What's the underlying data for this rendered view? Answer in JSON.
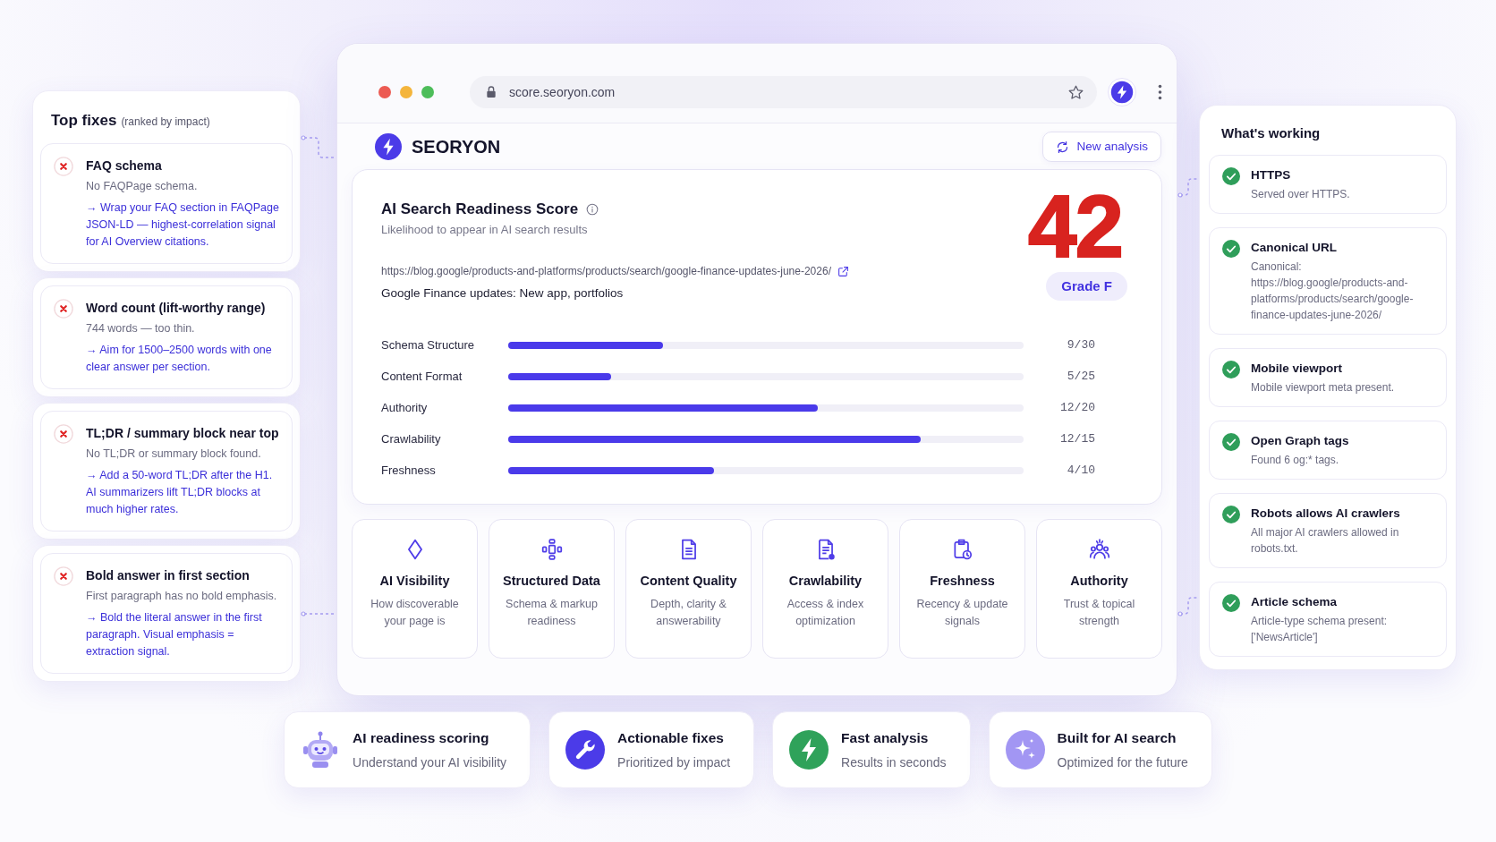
{
  "top_fixes": {
    "title": "Top fixes",
    "subtitle": "(ranked by impact)",
    "items": [
      {
        "title": "FAQ schema",
        "detail": "No FAQPage schema.",
        "fix": "→ Wrap your FAQ section in FAQPage JSON-LD — highest-correlation signal for AI Overview citations."
      },
      {
        "title": "Word count (lift-worthy range)",
        "detail": "744 words — too thin.",
        "fix": "→ Aim for 1500–2500 words with one clear answer per section."
      },
      {
        "title": "TL;DR / summary block near top",
        "detail": "No TL;DR or summary block found.",
        "fix": "→ Add a 50-word TL;DR after the H1. AI summarizers lift TL;DR blocks at much higher rates."
      },
      {
        "title": "Bold answer in first section",
        "detail": "First paragraph has no bold emphasis.",
        "fix": "→ Bold the literal answer in the first paragraph. Visual emphasis = extraction signal."
      }
    ]
  },
  "browser": {
    "url": "score.seoryon.com"
  },
  "header": {
    "brand": "SEORYON",
    "button": "New analysis"
  },
  "score_card": {
    "title": "AI Search Readiness Score",
    "subtitle": "Likelihood to appear in AI search results",
    "url": "https://blog.google/products-and-platforms/products/search/google-finance-updates-june-2026/",
    "page_title": "Google Finance updates: New app, portfolios",
    "score": "42",
    "grade": "Grade F",
    "metrics": [
      {
        "name": "Schema Structure",
        "level": 0.3,
        "reading": "9/30"
      },
      {
        "name": "Content Format",
        "level": 0.2,
        "reading": "5/25"
      },
      {
        "name": "Authority",
        "level": 0.6,
        "reading": "12/20"
      },
      {
        "name": "Crawlability",
        "level": 0.8,
        "reading": "12/15"
      },
      {
        "name": "Freshness",
        "level": 0.4,
        "reading": "4/10"
      }
    ]
  },
  "categories": [
    {
      "title": "AI Visibility",
      "description": "How discoverable your page is"
    },
    {
      "title": "Structured Data",
      "description": "Schema & markup readiness"
    },
    {
      "title": "Content Quality",
      "description": "Depth, clarity & answerability"
    },
    {
      "title": "Crawlability",
      "description": "Access & index optimization"
    },
    {
      "title": "Freshness",
      "description": "Recency & update signals"
    },
    {
      "title": "Authority",
      "description": "Trust & topical strength"
    }
  ],
  "whats_working": {
    "title": "What's working",
    "items": [
      {
        "title": "HTTPS",
        "detail": "Served over HTTPS."
      },
      {
        "title": "Canonical URL",
        "detail": "Canonical: https://blog.google/products-and-platforms/products/search/google-finance-updates-june-2026/"
      },
      {
        "title": "Mobile viewport",
        "detail": "Mobile viewport meta present."
      },
      {
        "title": "Open Graph tags",
        "detail": "Found 6 og:* tags."
      },
      {
        "title": "Robots allows AI crawlers",
        "detail": "All major AI crawlers allowed in robots.txt."
      },
      {
        "title": "Article schema",
        "detail": "Article-type schema present: ['NewsArticle']"
      }
    ]
  },
  "features": [
    {
      "title": "AI readiness scoring",
      "subtitle": "Understand your AI visibility"
    },
    {
      "title": "Actionable fixes",
      "subtitle": "Prioritized by impact"
    },
    {
      "title": "Fast analysis",
      "subtitle": "Results in seconds"
    },
    {
      "title": "Built for AI search",
      "subtitle": "Optimized for the future"
    }
  ]
}
